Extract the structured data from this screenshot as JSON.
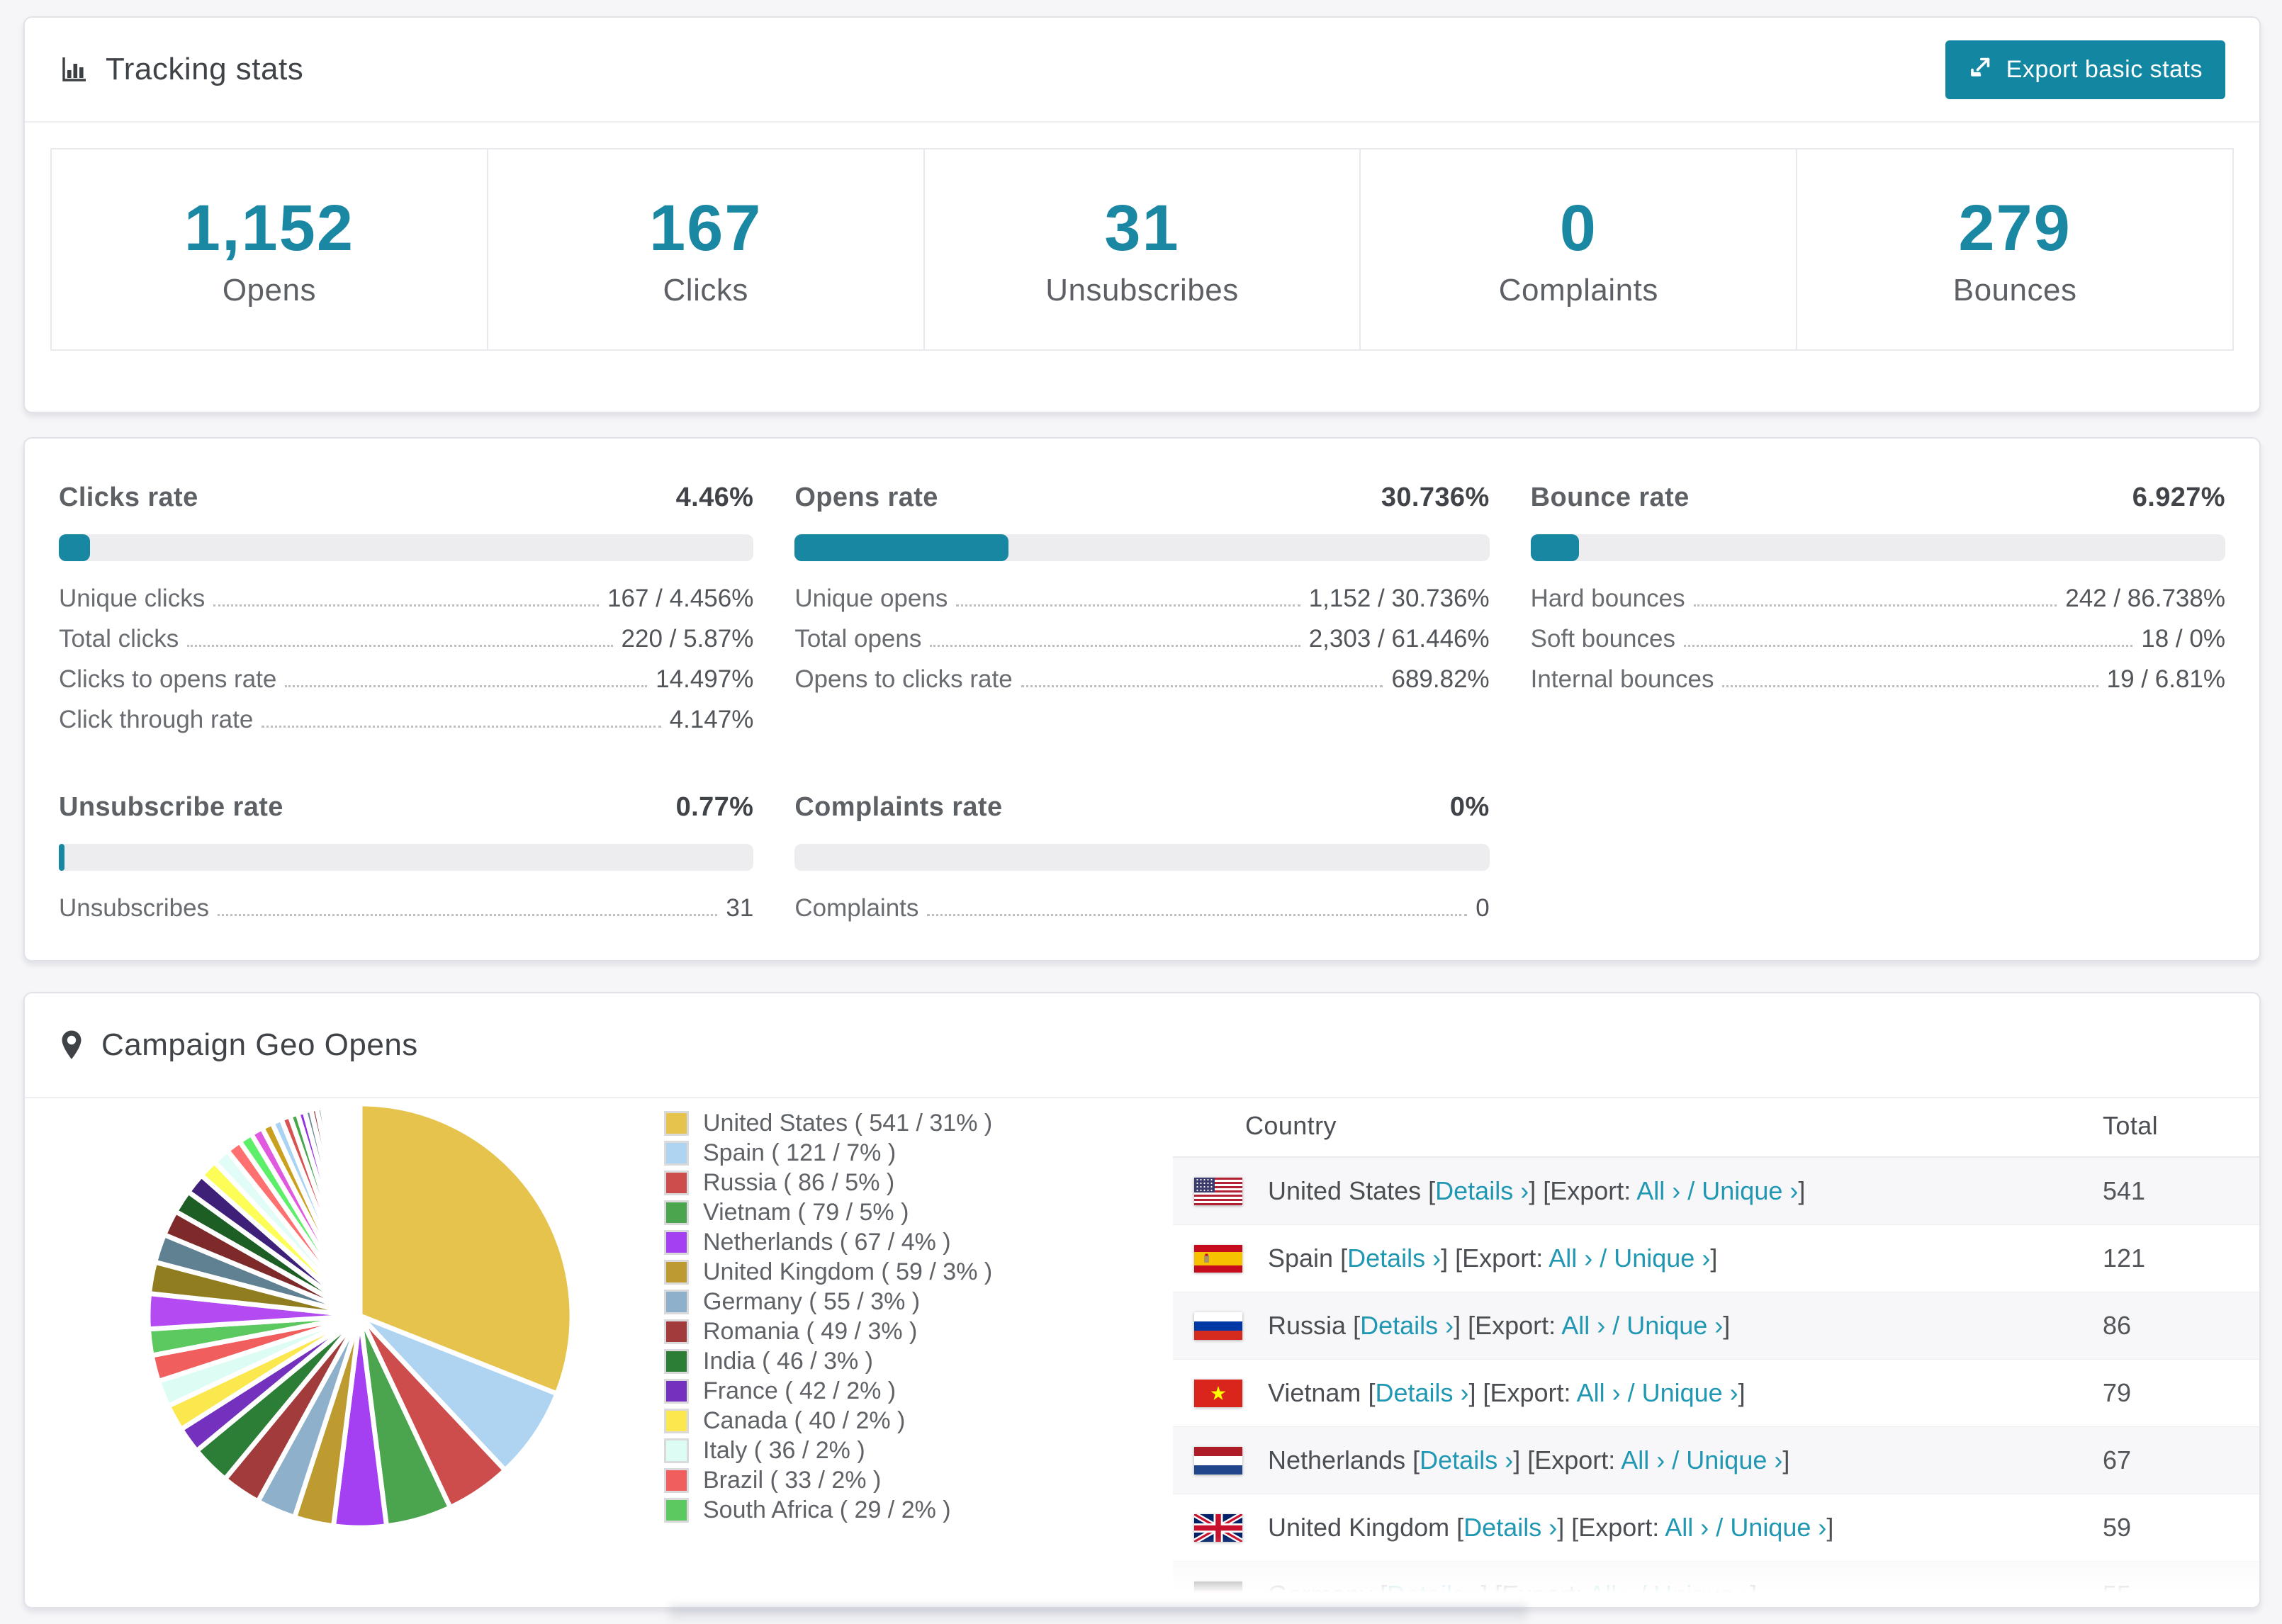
{
  "accent_color": "#1a87a3",
  "link_color": "#2097b3",
  "header": {
    "title": "Tracking stats",
    "export_label": "Export basic stats"
  },
  "summary_stats": [
    {
      "value": "1,152",
      "label": "Opens"
    },
    {
      "value": "167",
      "label": "Clicks"
    },
    {
      "value": "31",
      "label": "Unsubscribes"
    },
    {
      "value": "0",
      "label": "Complaints"
    },
    {
      "value": "279",
      "label": "Bounces"
    }
  ],
  "rates": [
    {
      "title": "Clicks rate",
      "value": "4.46%",
      "percent": 4.46,
      "rows": [
        {
          "label": "Unique clicks",
          "value": "167 / 4.456%"
        },
        {
          "label": "Total clicks",
          "value": "220 / 5.87%"
        },
        {
          "label": "Clicks to opens rate",
          "value": "14.497%"
        },
        {
          "label": "Click through rate",
          "value": "4.147%"
        }
      ]
    },
    {
      "title": "Opens rate",
      "value": "30.736%",
      "percent": 30.736,
      "rows": [
        {
          "label": "Unique opens",
          "value": "1,152 / 30.736%"
        },
        {
          "label": "Total opens",
          "value": "2,303 / 61.446%"
        },
        {
          "label": "Opens to clicks rate",
          "value": "689.82%"
        }
      ]
    },
    {
      "title": "Bounce rate",
      "value": "6.927%",
      "percent": 6.927,
      "rows": [
        {
          "label": "Hard bounces",
          "value": "242 / 86.738%"
        },
        {
          "label": "Soft bounces",
          "value": "18 / 0%"
        },
        {
          "label": "Internal bounces",
          "value": "19 / 6.81%"
        }
      ]
    },
    {
      "title": "Unsubscribe rate",
      "value": "0.77%",
      "percent": 0.77,
      "rows": [
        {
          "label": "Unsubscribes",
          "value": "31"
        }
      ]
    },
    {
      "title": "Complaints rate",
      "value": "0%",
      "percent": 0,
      "rows": [
        {
          "label": "Complaints",
          "value": "0"
        }
      ]
    }
  ],
  "geo": {
    "title": "Campaign Geo Opens",
    "countries": [
      {
        "name": "United States",
        "opens": 541,
        "pct": 31,
        "color": "#e6c34c",
        "flag": "us"
      },
      {
        "name": "Spain",
        "opens": 121,
        "pct": 7,
        "color": "#aed4f2",
        "flag": "es"
      },
      {
        "name": "Russia",
        "opens": 86,
        "pct": 5,
        "color": "#cd4d4d",
        "flag": "ru"
      },
      {
        "name": "Vietnam",
        "opens": 79,
        "pct": 5,
        "color": "#4aa54e",
        "flag": "vn"
      },
      {
        "name": "Netherlands",
        "opens": 67,
        "pct": 4,
        "color": "#a43ff2",
        "flag": "nl"
      },
      {
        "name": "United Kingdom",
        "opens": 59,
        "pct": 3,
        "color": "#bd9b31",
        "flag": "gb"
      },
      {
        "name": "Germany",
        "opens": 55,
        "pct": 3,
        "color": "#8fb0ca",
        "flag": "de"
      },
      {
        "name": "Romania",
        "opens": 49,
        "pct": 3,
        "color": "#a23c3c",
        "flag": "ro"
      },
      {
        "name": "India",
        "opens": 46,
        "pct": 3,
        "color": "#2c7d35",
        "flag": "in"
      },
      {
        "name": "France",
        "opens": 42,
        "pct": 2,
        "color": "#7331bd",
        "flag": "fr"
      },
      {
        "name": "Canada",
        "opens": 40,
        "pct": 2,
        "color": "#fbe84e",
        "flag": "ca"
      },
      {
        "name": "Italy",
        "opens": 36,
        "pct": 2,
        "color": "#dcfcf4",
        "flag": "it"
      },
      {
        "name": "Brazil",
        "opens": 33,
        "pct": 2,
        "color": "#f15e5e",
        "flag": "br"
      },
      {
        "name": "South Africa",
        "opens": 29,
        "pct": 2,
        "color": "#5bc95f",
        "flag": "za"
      }
    ],
    "table": {
      "columns": [
        "Country",
        "Total"
      ],
      "visible_rows": 7,
      "link_labels": {
        "lb": "[",
        "rb": "]",
        "details": "Details ›",
        "export_prefix": "Export:",
        "all": "All ›",
        "slash": "/",
        "unique": "Unique ›"
      }
    }
  },
  "chart_data": {
    "type": "pie",
    "title": "Campaign Geo Opens",
    "labels": [
      "United States",
      "Spain",
      "Russia",
      "Vietnam",
      "Netherlands",
      "United Kingdom",
      "Germany",
      "Romania",
      "India",
      "France",
      "Canada",
      "Italy",
      "Brazil",
      "South Africa"
    ],
    "values": [
      541,
      121,
      86,
      79,
      67,
      59,
      55,
      49,
      46,
      42,
      40,
      36,
      33,
      29
    ],
    "percents": [
      31,
      7,
      5,
      5,
      4,
      3,
      3,
      3,
      3,
      2,
      2,
      2,
      2,
      2
    ],
    "others_percent": 26,
    "start_angle_deg": -90,
    "direction": "clockwise",
    "legend_position": "right"
  }
}
